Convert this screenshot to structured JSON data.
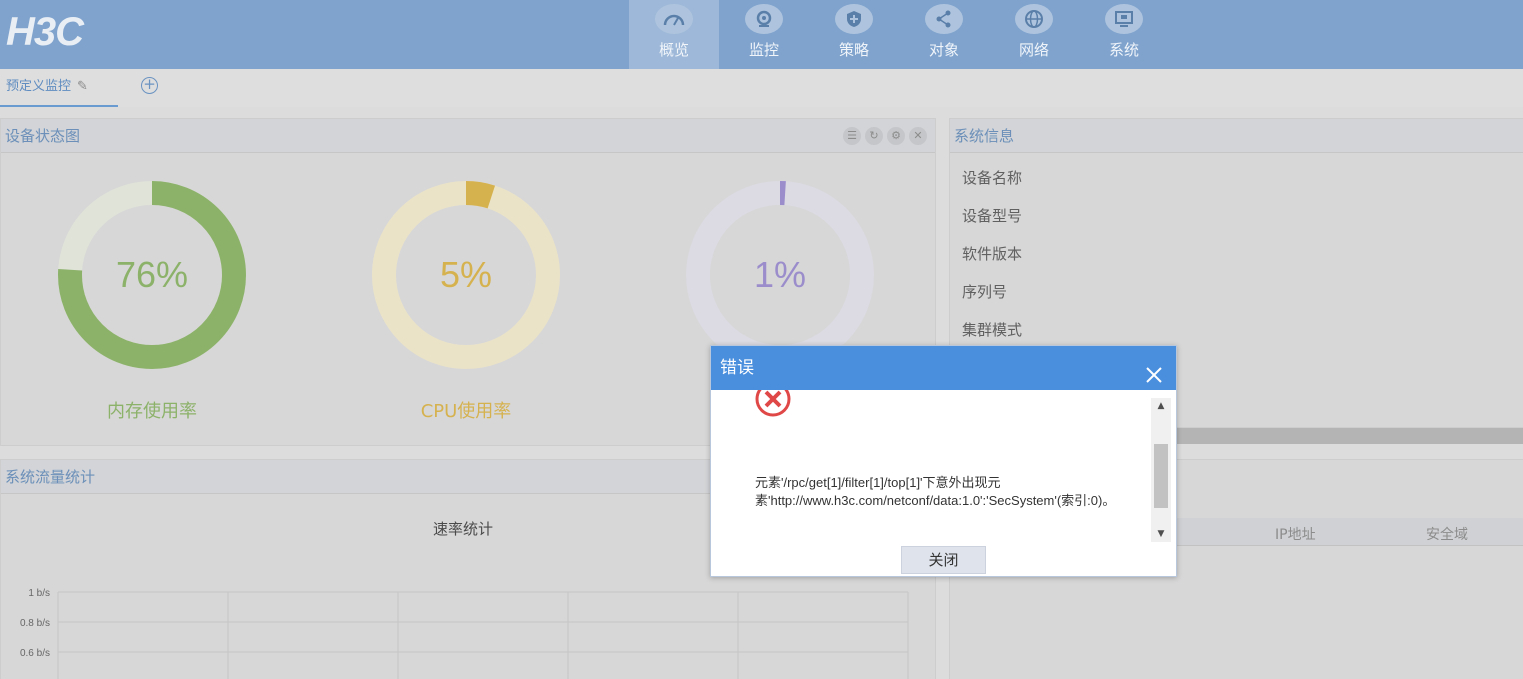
{
  "header": {
    "logo": "H3C",
    "nav": [
      {
        "label": "概览",
        "icon": "dashboard-icon",
        "active": true
      },
      {
        "label": "监控",
        "icon": "camera-icon",
        "active": false
      },
      {
        "label": "策略",
        "icon": "shield-icon",
        "active": false
      },
      {
        "label": "对象",
        "icon": "share-icon",
        "active": false
      },
      {
        "label": "网络",
        "icon": "globe-icon",
        "active": false
      },
      {
        "label": "系统",
        "icon": "monitor-icon",
        "active": false
      }
    ]
  },
  "tabs": {
    "active_label": "预定义监控"
  },
  "device_panel": {
    "title": "设备状态图",
    "gauges": [
      {
        "value": "76%",
        "fraction": 0.76,
        "label": "内存使用率",
        "color": "#8cb26a"
      },
      {
        "value": "5%",
        "fraction": 0.05,
        "label": "CPU使用率",
        "color": "#d6b24f"
      },
      {
        "value": "1%",
        "fraction": 0.01,
        "label": "",
        "color": "#9b8dcc"
      }
    ]
  },
  "system_info": {
    "title": "系统信息",
    "rows": [
      "设备名称",
      "设备型号",
      "软件版本",
      "序列号",
      "集群模式"
    ]
  },
  "traffic_panel": {
    "title": "系统流量统计",
    "chart_title": "速率统计"
  },
  "chart_data": {
    "type": "line",
    "title": "速率统计",
    "yticks": [
      "1 b/s",
      "0.8 b/s",
      "0.6 b/s"
    ],
    "series": []
  },
  "right_table": {
    "columns": [
      "IP地址",
      "安全域"
    ]
  },
  "modal": {
    "title": "错误",
    "message": "元素'/rpc/get[1]/filter[1]/top[1]'下意外出现元素'http://www.h3c.com/netconf/data:1.0':'SecSystem'(索引:0)。",
    "close_button": "关闭"
  }
}
